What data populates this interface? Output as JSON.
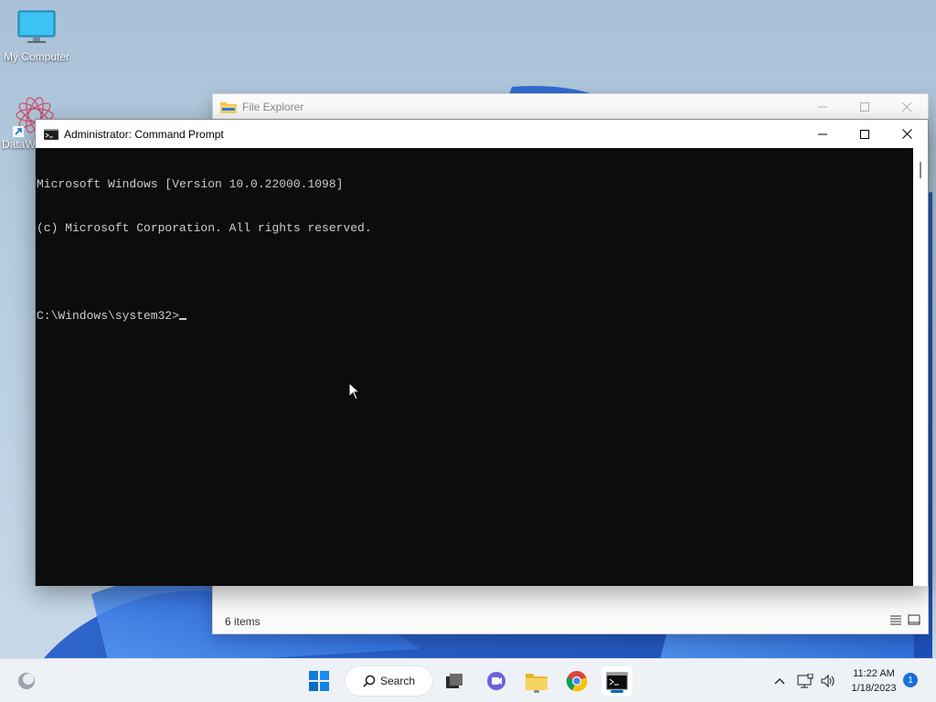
{
  "desktop": {
    "icons": [
      {
        "label": "My Computer",
        "icon": "monitor-icon"
      },
      {
        "label": "DataW",
        "icon": "datawrapper-shortcut-icon"
      }
    ]
  },
  "file_explorer": {
    "title": "File Explorer",
    "status_items": "6 items"
  },
  "command_prompt": {
    "title": "Administrator:  Command Prompt",
    "lines": [
      "Microsoft Windows [Version 10.0.22000.1098]",
      "(c) Microsoft Corporation. All rights reserved.",
      "",
      "C:\\Windows\\system32>"
    ]
  },
  "taskbar": {
    "search_label": "Search",
    "apps": [
      "start-icon",
      "search",
      "task-view-icon",
      "teams-chat-icon",
      "file-explorer-icon",
      "chrome-icon",
      "terminal-icon"
    ],
    "time": "11:22 AM",
    "date": "1/18/2023",
    "notification_count": "1"
  },
  "colors": {
    "console_bg": "#0c0c0c",
    "console_fg": "#cccccc",
    "accent": "#0067c0"
  }
}
